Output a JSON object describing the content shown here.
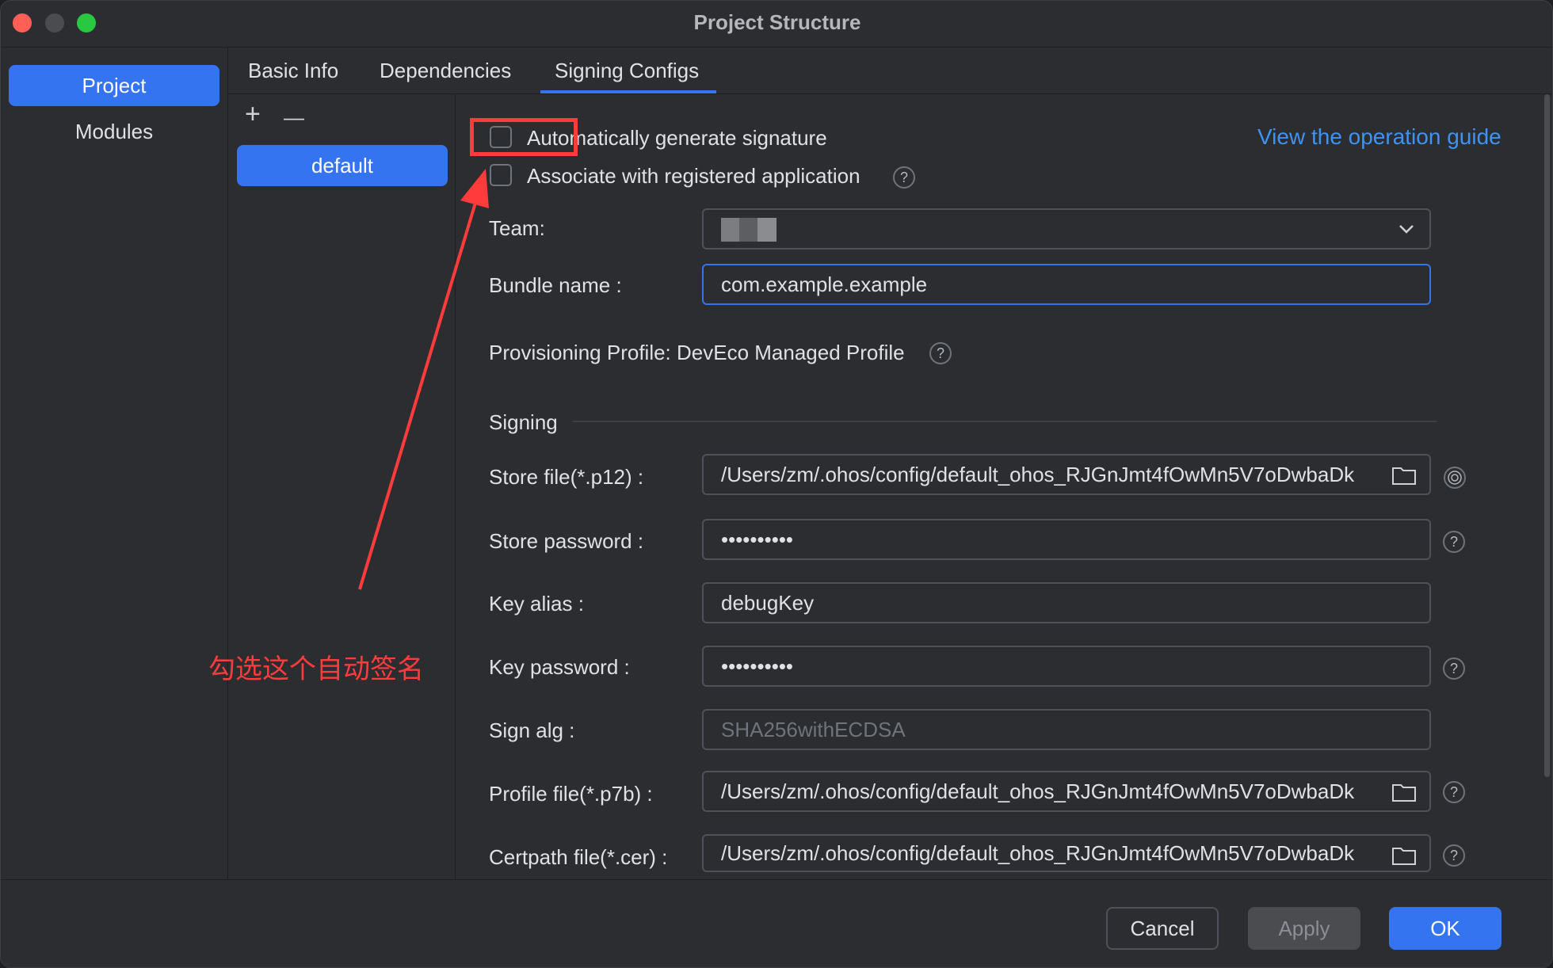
{
  "window": {
    "title": "Project Structure"
  },
  "leftnav": {
    "items": [
      {
        "label": "Project",
        "active": true
      },
      {
        "label": "Modules",
        "active": false
      }
    ]
  },
  "tabs": [
    {
      "label": "Basic Info"
    },
    {
      "label": "Dependencies"
    },
    {
      "label": "Signing Configs",
      "active": true
    }
  ],
  "configs": {
    "add": "+",
    "remove": "—",
    "items": [
      {
        "label": "default"
      }
    ]
  },
  "options": {
    "auto_sign_label": "Automatically generate signature",
    "auto_sign_checked": false,
    "associate_label": "Associate with registered application",
    "associate_checked": false,
    "guide_link": "View the operation guide"
  },
  "form": {
    "team_label": "Team:",
    "team_value": "",
    "bundle_label": "Bundle name :",
    "bundle_value": "com.example.example",
    "profile_text": "Provisioning Profile: DevEco Managed Profile",
    "signing_section": "Signing",
    "store_file_label": "Store file(*.p12) :",
    "store_file_value": "/Users/zm/.ohos/config/default_ohos_RJGnJmt4fOwMn5V7oDwbaDk",
    "store_password_label": "Store password :",
    "store_password_value": "••••••••••",
    "key_alias_label": "Key alias :",
    "key_alias_value": "debugKey",
    "key_password_label": "Key password :",
    "key_password_value": "••••••••••",
    "sign_alg_label": "Sign alg :",
    "sign_alg_value": "SHA256withECDSA",
    "profile_file_label": "Profile file(*.p7b) :",
    "profile_file_value": "/Users/zm/.ohos/config/default_ohos_RJGnJmt4fOwMn5V7oDwbaDk",
    "cert_file_label": "Certpath file(*.cer) :",
    "cert_file_value": "/Users/zm/.ohos/config/default_ohos_RJGnJmt4fOwMn5V7oDwbaDk"
  },
  "footer": {
    "cancel": "Cancel",
    "apply": "Apply",
    "ok": "OK"
  },
  "annotation": {
    "text": "勾选这个自动签名",
    "color": "#ff3b3b"
  },
  "help_glyph": "?",
  "colors": {
    "accent": "#3574f0",
    "link": "#3e93f4",
    "background": "#2b2d30"
  }
}
